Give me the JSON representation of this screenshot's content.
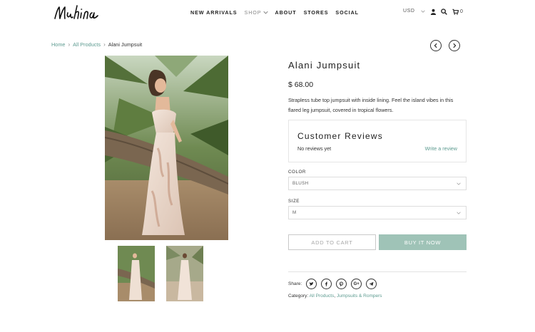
{
  "header": {
    "logo_text": "Mahina",
    "nav": [
      "NEW ARRIVALS",
      "SHOP",
      "ABOUT",
      "STORES",
      "SOCIAL"
    ],
    "currency": "USD",
    "cart_count": "0"
  },
  "breadcrumb": {
    "home": "Home",
    "all_products": "All Products",
    "current": "Alani Jumpsuit"
  },
  "product": {
    "title": "Alani Jumpsuit",
    "price": "$ 68.00",
    "description": "Strapless tube top jumpsuit with inside lining. Feel the island vibes in this flared leg jumpsuit, covered in tropical flowers."
  },
  "reviews": {
    "title": "Customer Reviews",
    "none_text": "No reviews yet",
    "write_link": "Write a review"
  },
  "options": {
    "color_label": "COLOR",
    "color_value": "BLUSH",
    "size_label": "SIZE",
    "size_value": "M"
  },
  "buttons": {
    "add_to_cart": "ADD TO CART",
    "buy_now": "BUY IT NOW"
  },
  "share": {
    "label": "Share:",
    "icons": [
      "twitter-icon",
      "facebook-icon",
      "pinterest-icon",
      "google-plus-icon",
      "telegram-icon"
    ],
    "google_plus_text": "G+"
  },
  "category": {
    "label": "Category:",
    "link1": "All Products",
    "separator": ",",
    "link2": "Jumpsuits & Rompers"
  },
  "colors": {
    "accent": "#5d9b90",
    "buy_button": "#9fc3b7"
  }
}
